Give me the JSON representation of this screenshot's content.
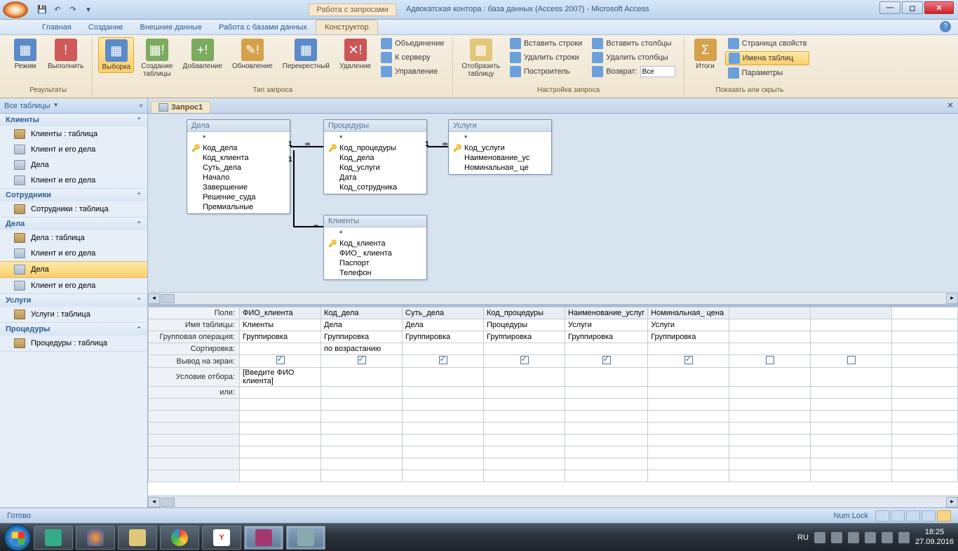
{
  "title": {
    "contextual": "Работа с запросами",
    "main": "Адвокатская контора : база данных (Access 2007) - Microsoft Access"
  },
  "ribbon_tabs": {
    "home": "Главная",
    "create": "Создание",
    "external": "Внешние данные",
    "dbtools": "Работа с базами данных",
    "design": "Конструктор"
  },
  "ribbon": {
    "results": {
      "label": "Результаты",
      "view": "Режим",
      "run": "Выполнить"
    },
    "qtype": {
      "label": "Тип запроса",
      "select": "Выборка",
      "maketable": "Создание\nтаблицы",
      "append": "Добавление",
      "update": "Обновление",
      "crosstab": "Перекрестный",
      "delete": "Удаление",
      "union": "Объединение",
      "passthrough": "К серверу",
      "datadef": "Управление"
    },
    "setup": {
      "label": "Настройка запроса",
      "showtable": "Отобразить\nтаблицу",
      "insrow": "Вставить строки",
      "delrow": "Удалить строки",
      "builder": "Построитель",
      "inscol": "Вставить столбцы",
      "delcol": "Удалить столбцы",
      "return": "Возврат:",
      "return_val": "Все"
    },
    "showhide": {
      "label": "Показать или скрыть",
      "totals": "Итоги",
      "props": "Страница свойств",
      "tablenames": "Имена таблиц",
      "params": "Параметры"
    }
  },
  "nav": {
    "header": "Все таблицы",
    "groups": [
      {
        "name": "Клиенты",
        "items": [
          "Клиенты : таблица",
          "Клиент и его дела",
          "Дела",
          "Клиент и его дела"
        ],
        "types": [
          "t",
          "q",
          "q",
          "q"
        ]
      },
      {
        "name": "Сотрудники",
        "items": [
          "Сотрудники : таблица"
        ],
        "types": [
          "t"
        ]
      },
      {
        "name": "Дела",
        "items": [
          "Дела : таблица",
          "Клиент и его дела",
          "Дела",
          "Клиент и его дела"
        ],
        "types": [
          "t",
          "q",
          "q",
          "q"
        ],
        "selected": 2
      },
      {
        "name": "Услуги",
        "items": [
          "Услуги : таблица"
        ],
        "types": [
          "t"
        ]
      },
      {
        "name": "Процедуры",
        "items": [
          "Процедуры : таблица"
        ],
        "types": [
          "t"
        ]
      }
    ]
  },
  "doc_tab": "Запрос1",
  "tables": {
    "dela": {
      "title": "Дела",
      "fields": [
        "*",
        "Код_дела",
        "Код_клиента",
        "Суть_дела",
        "Начало",
        "Завершение",
        "Решение_суда",
        "Премиальные"
      ],
      "key": 1
    },
    "proc": {
      "title": "Процедуры",
      "fields": [
        "*",
        "Код_процедуры",
        "Код_дела",
        "Код_услуги",
        "Дата",
        "Код_сотрудника"
      ],
      "key": 1
    },
    "uslugi": {
      "title": "Услуги",
      "fields": [
        "*",
        "Код_услуги",
        "Наименование_ус",
        "Номинальная_ це"
      ],
      "key": 1
    },
    "klienty": {
      "title": "Клиенты",
      "fields": [
        "*",
        "Код_клиента",
        "ФИО_ клиента",
        "Паспорт",
        "Телефон"
      ],
      "key": 1
    }
  },
  "grid": {
    "rowlabels": {
      "field": "Поле:",
      "table": "Имя таблицы:",
      "total": "Групповая операция:",
      "sort": "Сортировка:",
      "show": "Вывод на экран:",
      "criteria": "Условие отбора:",
      "or": "или:"
    },
    "cols": [
      {
        "field": "ФИО_клиента",
        "table": "Клиенты",
        "total": "Группировка",
        "sort": "",
        "show": true,
        "criteria": "[Введите ФИО клиента]"
      },
      {
        "field": "Код_дела",
        "table": "Дела",
        "total": "Группировка",
        "sort": "по возрастанию",
        "show": true,
        "criteria": ""
      },
      {
        "field": "Суть_дела",
        "table": "Дела",
        "total": "Группировка",
        "sort": "",
        "show": true,
        "criteria": ""
      },
      {
        "field": "Код_процедуры",
        "table": "Процедуры",
        "total": "Группировка",
        "sort": "",
        "show": true,
        "criteria": ""
      },
      {
        "field": "Наименование_услуг",
        "table": "Услуги",
        "total": "Группировка",
        "sort": "",
        "show": true,
        "criteria": ""
      },
      {
        "field": "Номинальная_ цена",
        "table": "Услуги",
        "total": "Группировка",
        "sort": "",
        "show": true,
        "criteria": ""
      }
    ]
  },
  "status": {
    "ready": "Готово",
    "numlock": "Num Lock"
  },
  "taskbar": {
    "lang": "RU",
    "time": "18:25",
    "date": "27.09.2016"
  }
}
